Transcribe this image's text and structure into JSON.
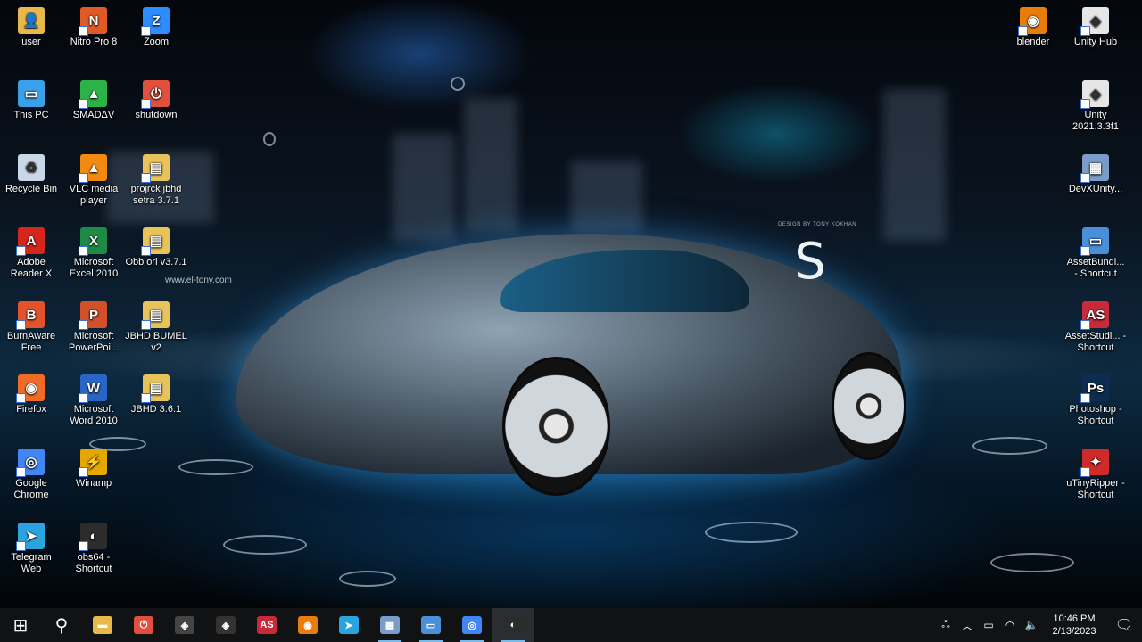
{
  "desktop": {
    "wallpaper_credit": "DESIGN BY TONY KOKHAN",
    "wallpaper_watermark": "www.el-tony.com",
    "wallpaper_logo": "S",
    "icons": [
      {
        "label": "user",
        "icon": "folder-user-icon",
        "color": "#e8b94a"
      },
      {
        "label": "Nitro Pro 8",
        "icon": "nitro-pdf-icon",
        "color": "#e05a26"
      },
      {
        "label": "Zoom",
        "icon": "zoom-icon",
        "color": "#2d8cff"
      },
      {
        "label": "This PC",
        "icon": "computer-icon",
        "color": "#3aa0e8"
      },
      {
        "label": "SMADΔV",
        "icon": "smadav-icon",
        "color": "#2bb34a"
      },
      {
        "label": "shutdown",
        "icon": "power-icon",
        "color": "#e0503c"
      },
      {
        "label": "Recycle Bin",
        "icon": "recycle-bin-icon",
        "color": "#c9d7e6"
      },
      {
        "label": "VLC media player",
        "icon": "vlc-icon",
        "color": "#f28a12"
      },
      {
        "label": "projrck jbhd setra 3.7.1",
        "icon": "folder-icon",
        "color": "#e8c25a"
      },
      {
        "label": "Adobe Reader X",
        "icon": "adobe-reader-icon",
        "color": "#d6261c"
      },
      {
        "label": "Microsoft Excel 2010",
        "icon": "excel-icon",
        "color": "#1f8a45"
      },
      {
        "label": "Obb ori v3.7.1",
        "icon": "folder-icon",
        "color": "#e8c25a"
      },
      {
        "label": "BurnAware Free",
        "icon": "burnaware-icon",
        "color": "#e2532b"
      },
      {
        "label": "Microsoft PowerPoi...",
        "icon": "powerpoint-icon",
        "color": "#d2502a"
      },
      {
        "label": "JBHD BUMEL v2",
        "icon": "folder-icon",
        "color": "#e8c25a"
      },
      {
        "label": "Firefox",
        "icon": "firefox-icon",
        "color": "#f06b25"
      },
      {
        "label": "Microsoft Word 2010",
        "icon": "word-icon",
        "color": "#2a64c5"
      },
      {
        "label": "JBHD 3.6.1",
        "icon": "folder-icon",
        "color": "#e8c25a"
      },
      {
        "label": "Google Chrome",
        "icon": "chrome-icon",
        "color": "#4285f4"
      },
      {
        "label": "Winamp",
        "icon": "winamp-icon",
        "color": "#e4a800"
      },
      {
        "label": "Telegram Web",
        "icon": "telegram-icon",
        "color": "#2aa3df"
      },
      {
        "label": "obs64 - Shortcut",
        "icon": "obs-icon",
        "color": "#2c2c2c"
      },
      {
        "label": "blender",
        "icon": "blender-icon",
        "color": "#e87d0d"
      },
      {
        "label": "Unity Hub",
        "icon": "unity-hub-icon",
        "color": "#e6e6e6"
      },
      {
        "label": "Unity 2021.3.3f1",
        "icon": "unity-icon",
        "color": "#e6e6e6"
      },
      {
        "label": "DevXUnity...",
        "icon": "devxunity-icon",
        "color": "#7a9cc8"
      },
      {
        "label": "AssetBundl... - Shortcut",
        "icon": "window-icon",
        "color": "#4a8fd8"
      },
      {
        "label": "AssetStudi... - Shortcut",
        "icon": "assetstudio-icon",
        "color": "#c82a3a"
      },
      {
        "label": "Photoshop - Shortcut",
        "icon": "photoshop-icon",
        "color": "#0c2d4f"
      },
      {
        "label": "uTinyRipper - Shortcut",
        "icon": "utinyripper-icon",
        "color": "#cf2b2b"
      }
    ]
  },
  "taskbar": {
    "start": "⊞",
    "search": "⚲",
    "apps": [
      {
        "icon": "file-explorer-icon",
        "glyph": "▬",
        "color": "#e8b94a",
        "running": false,
        "active": false
      },
      {
        "icon": "shutdown-app-icon",
        "glyph": "⏻",
        "color": "#e0503c",
        "running": false,
        "active": false
      },
      {
        "icon": "unity-hub-taskbar-icon",
        "glyph": "◈",
        "color": "#444",
        "running": false,
        "active": false
      },
      {
        "icon": "unity-taskbar-icon",
        "glyph": "◈",
        "color": "#333",
        "running": false,
        "active": false
      },
      {
        "icon": "assetstudio-taskbar-icon",
        "glyph": "AS",
        "color": "#c82a3a",
        "running": false,
        "active": false
      },
      {
        "icon": "blender-taskbar-icon",
        "glyph": "◉",
        "color": "#e87d0d",
        "running": false,
        "active": false
      },
      {
        "icon": "telegram-taskbar-icon",
        "glyph": "➤",
        "color": "#2aa3df",
        "running": false,
        "active": false
      },
      {
        "icon": "devxunity-taskbar-icon",
        "glyph": "▦",
        "color": "#7a9cc8",
        "running": true,
        "active": false
      },
      {
        "icon": "window-taskbar-icon",
        "glyph": "▭",
        "color": "#4a8fd8",
        "running": true,
        "active": false
      },
      {
        "icon": "chrome-taskbar-icon",
        "glyph": "◎",
        "color": "#4285f4",
        "running": true,
        "active": false
      },
      {
        "icon": "obs-taskbar-icon",
        "glyph": "◐",
        "color": "#2c2c2c",
        "running": true,
        "active": true
      }
    ],
    "tray": {
      "people": "ஃ",
      "chevron": "︿",
      "battery": "▭",
      "network": "◠",
      "volume": "🔈",
      "time": "10:46 PM",
      "date": "2/13/2023",
      "notification": "🗨"
    }
  }
}
